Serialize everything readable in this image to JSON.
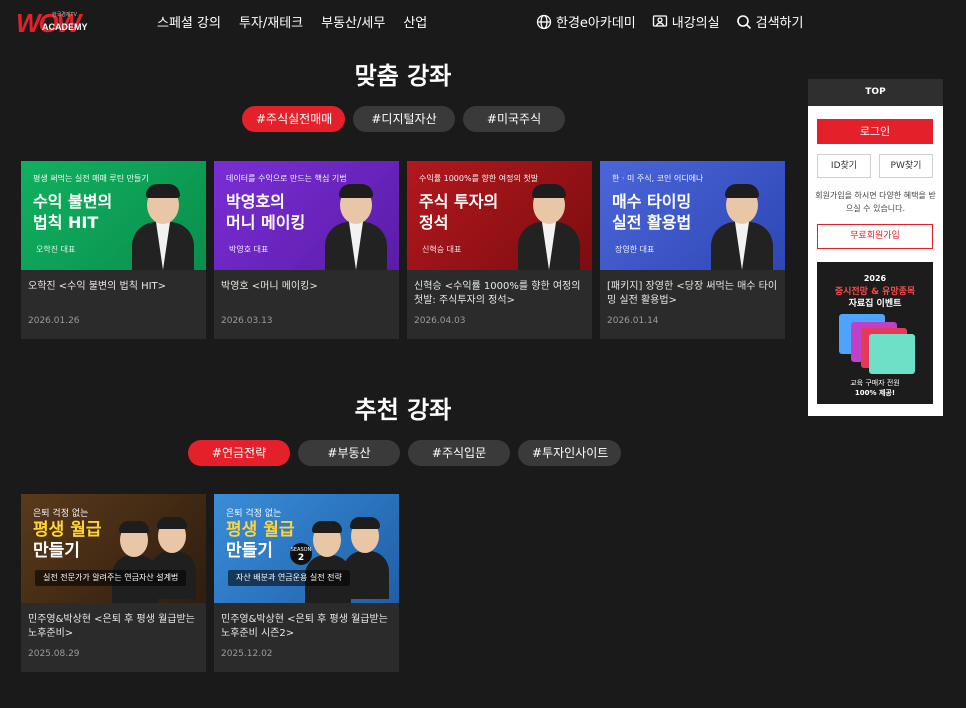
{
  "header": {
    "logo_sub": "한국경제TV",
    "logo_w": "WOW",
    "logo_text": "ACADEMY",
    "nav": [
      "스페셜 강의",
      "투자/재테크",
      "부동산/세무",
      "산업"
    ],
    "util": {
      "academy": "한경e아카데미",
      "my_class": "내강의실",
      "search": "검색하기"
    }
  },
  "custom": {
    "title": "맞춤 강좌",
    "tags": [
      "#주식실전매매",
      "#디지털자산",
      "#미국주식"
    ],
    "active_tag": 0,
    "cards": [
      {
        "thumb_small": "평생 써먹는 실전 매매 루틴 만들기",
        "thumb_line1": "수익 불변의",
        "thumb_line2": "법칙 HIT",
        "thumb_name": "오학진 대표",
        "title": "오학진 <수익 불변의 법칙 HIT>",
        "date": "2026.01.26"
      },
      {
        "thumb_small": "데이터를 수익으로 만드는 핵심 기법",
        "thumb_line1": "박영호의",
        "thumb_line2": "머니 메이킹",
        "thumb_name": "박영호 대표",
        "title": "박영호 <머니 메이킹>",
        "date": "2026.03.13"
      },
      {
        "thumb_small": "수익률 1000%를 향한 여정의 첫발",
        "thumb_line1": "주식 투자의",
        "thumb_line2": "정석",
        "thumb_name": "신혁승 대표",
        "title": "신혁승 <수익률 1000%를 향한 여정의 첫발: 주식투자의 정석>",
        "date": "2026.04.03"
      },
      {
        "thumb_small": "한 · 미 주식, 코인 어디에나",
        "thumb_line1": "매수 타이밍",
        "thumb_line2": "실전 활용법",
        "thumb_name": "장영한 대표",
        "title": "[패키지] 장영한 <당장 써먹는 매수 타이밍 실전 활용법>",
        "date": "2026.01.14"
      }
    ]
  },
  "recommend": {
    "title": "추천 강좌",
    "tags": [
      "#연금전략",
      "#부동산",
      "#주식입문",
      "#투자인사이트"
    ],
    "active_tag": 0,
    "cards": [
      {
        "thumb_small": "은퇴 걱정 없는",
        "thumb_line1": "평생 월급",
        "thumb_line2": "만들기",
        "thumb_sub": "실전 전문가가 알려주는 연금자산 설계법",
        "title": "민주영&박상현 <은퇴 후 평생 월급받는 노후준비>",
        "date": "2025.08.29"
      },
      {
        "thumb_small": "은퇴 걱정 없는",
        "thumb_line1": "평생 월급",
        "thumb_line2": "만들기",
        "season_label": "SEASON",
        "season_num": "2",
        "thumb_sub": "자산 배분과 연금운용 실전 전략",
        "title": "민주영&박상현 <은퇴 후 평생 월급받는 노후준비 시즌2>",
        "date": "2025.12.02"
      }
    ]
  },
  "side": {
    "top_label": "TOP",
    "login": "로그인",
    "id_find": "ID찾기",
    "pw_find": "PW찾기",
    "info": "회원가입을 하시면 다양한 혜택을 받으실 수 있습니다.",
    "join": "무료회원가입",
    "event": {
      "year": "2026",
      "line1": "증시전망 & 유망종목",
      "line2": "자료집 이벤트",
      "foot1": "교육 구매자 전원",
      "foot2": "100% 제공!"
    }
  },
  "colors": {
    "accent": "#e4202a",
    "background": "#1a1a1a",
    "card": "#2b2b2b",
    "tag": "#3a3a3a"
  }
}
